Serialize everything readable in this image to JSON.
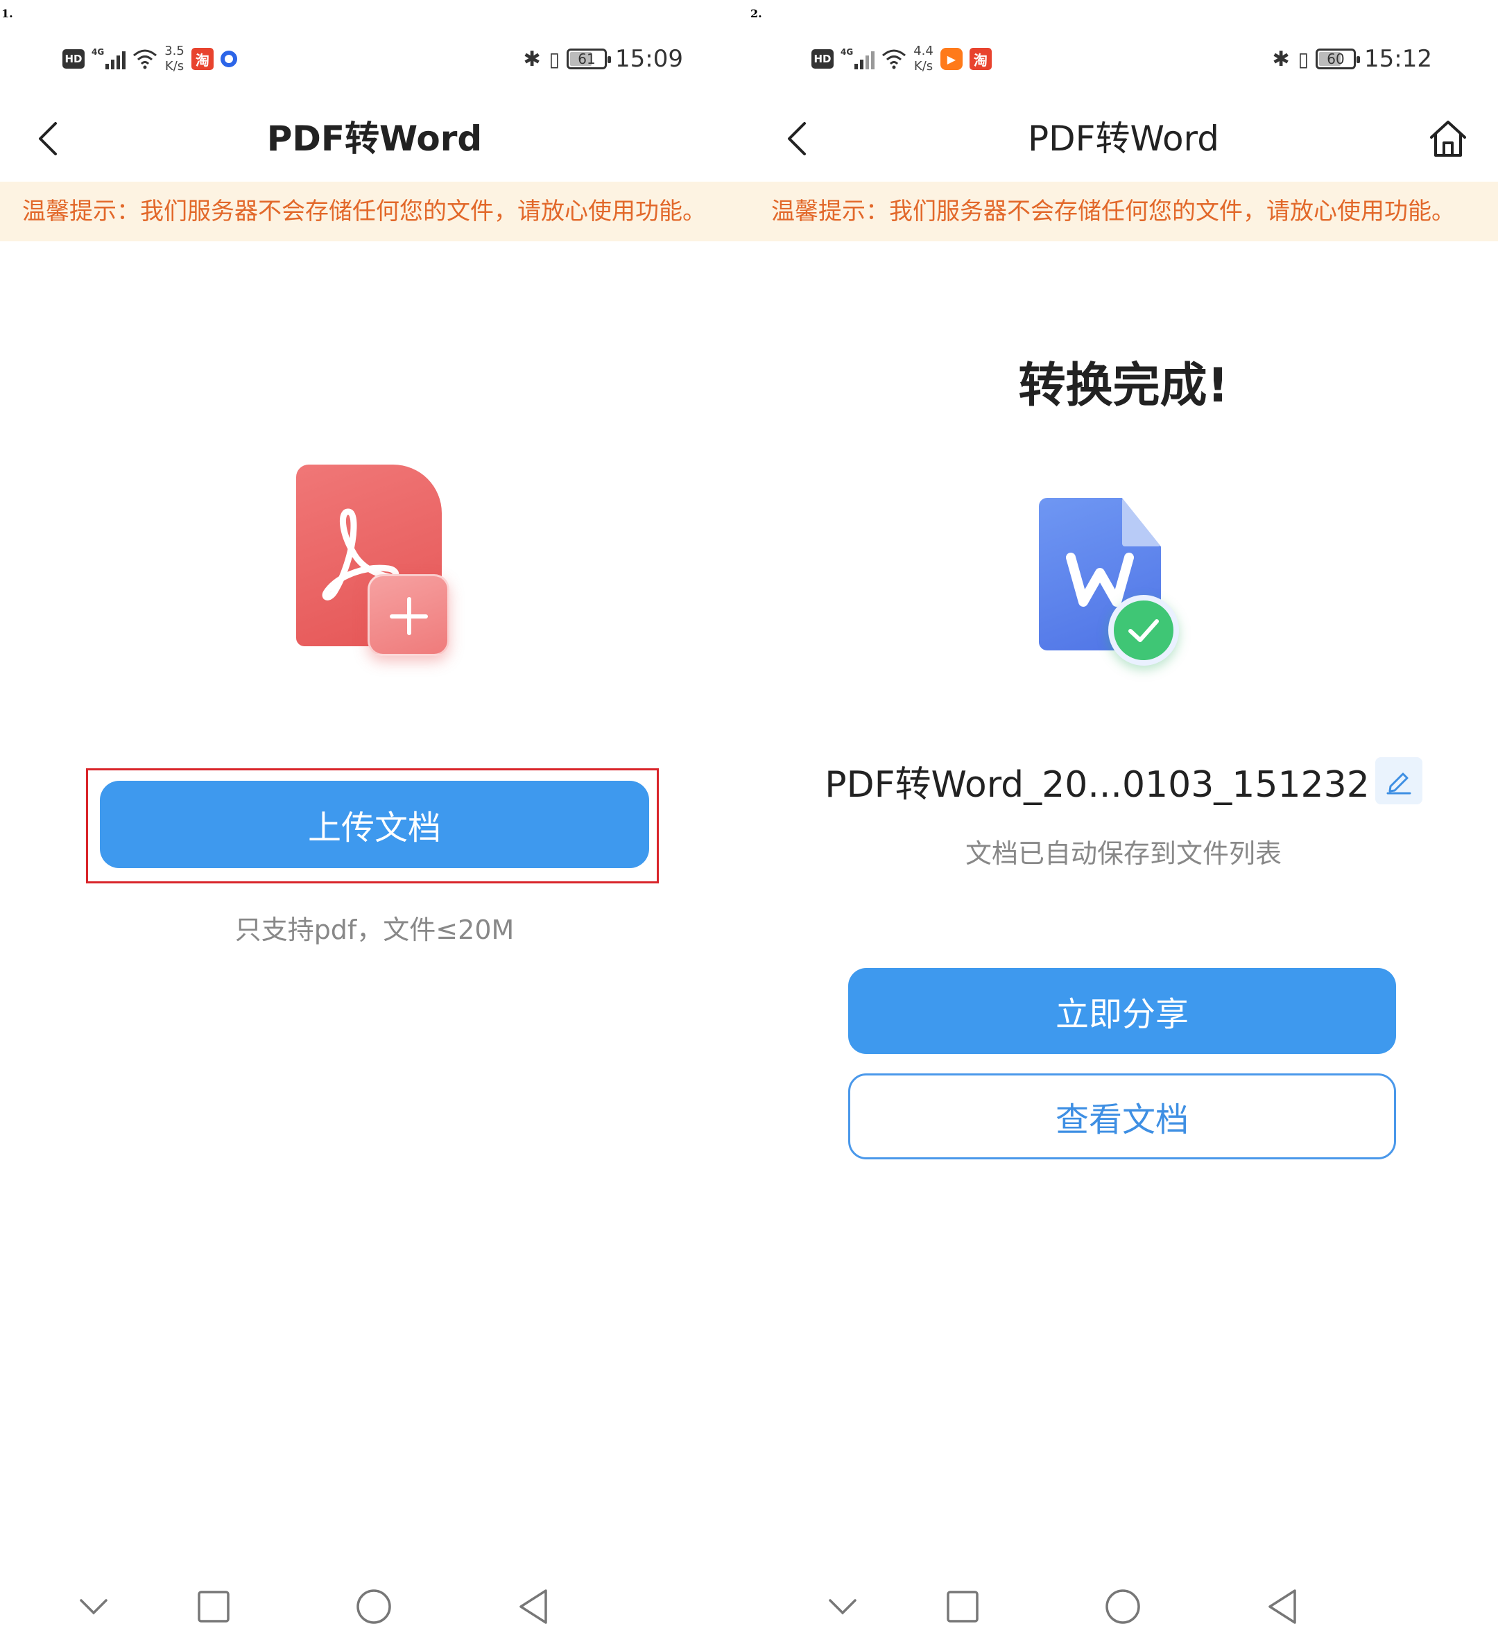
{
  "screens": [
    {
      "step": "1.",
      "status": {
        "net_speed_value": "3.5",
        "net_speed_unit": "K/s",
        "network": "4G",
        "hd": "HD",
        "app1": "淘",
        "battery": "61",
        "time": "15:09"
      },
      "header": {
        "title": "PDF转Word"
      },
      "notice": "温馨提示：我们服务器不会存储任何您的文件，请放心使用功能。",
      "upload_button": "上传文档",
      "upload_hint": "只支持pdf，文件≤20M",
      "colors": {
        "primary": "#3e99ee",
        "highlight": "#d9252a",
        "pdf": "#e55656"
      }
    },
    {
      "step": "2.",
      "status": {
        "net_speed_value": "4.4",
        "net_speed_unit": "K/s",
        "network": "4G",
        "hd": "HD",
        "app1": "▶",
        "app2": "淘",
        "battery": "60",
        "time": "15:12"
      },
      "header": {
        "title": "PDF转Word"
      },
      "notice": "温馨提示：我们服务器不会存储任何您的文件，请放心使用功能。",
      "done_title": "转换完成!",
      "filename": "PDF转Word_20...0103_151232",
      "saved_hint": "文档已自动保存到文件列表",
      "share_button": "立即分享",
      "view_button": "查看文档",
      "colors": {
        "primary": "#3e99ee",
        "success": "#3fc675",
        "word": "#5a7fea"
      }
    }
  ],
  "icons": [
    "back-icon",
    "home-icon",
    "pdf-icon",
    "add-icon",
    "word-icon",
    "check-icon",
    "edit-icon",
    "nav-down-icon",
    "nav-recent-icon",
    "nav-home-icon",
    "nav-back-icon"
  ]
}
